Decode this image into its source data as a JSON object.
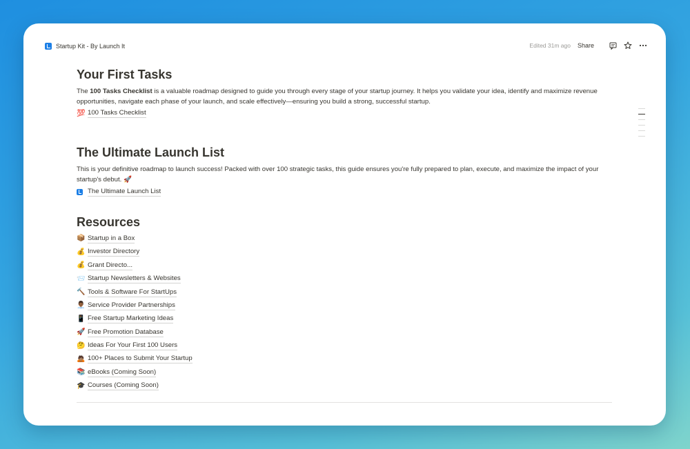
{
  "header": {
    "breadcrumb_title": "Startup Kit - By Launch It",
    "edited": "Edited 31m ago",
    "share_label": "Share"
  },
  "sections": {
    "first_tasks": {
      "title": "Your First Tasks",
      "desc_bold": "100 Tasks Checklist",
      "desc_pre": "The ",
      "desc_rest": " is a valuable roadmap designed to guide you through every stage of your startup journey. It helps you validate your idea, identify and maximize revenue opportunities, navigate each phase of your launch, and scale effectively—ensuring you build a strong, successful startup.",
      "link_emoji": "💯",
      "link_label": "100 Tasks Checklist"
    },
    "launch_list": {
      "title": "The Ultimate Launch List",
      "desc": "This is your definitive roadmap to launch success! Packed with over 100 strategic tasks, this guide ensures you're fully prepared to plan, execute, and maximize the impact of your startup's debut. 🚀",
      "link_label": "The Ultimate Launch List"
    },
    "resources": {
      "title": "Resources",
      "items": [
        {
          "emoji": "📦",
          "label": "Startup in a Box"
        },
        {
          "emoji": "💰",
          "label": "Investor Directory"
        },
        {
          "emoji": "💰",
          "label": "Grant Directo..."
        },
        {
          "emoji": "📨",
          "label": "Startup Newsletters & Websites"
        },
        {
          "emoji": "🔨",
          "label": "Tools & Software For StartUps"
        },
        {
          "emoji": "👨🏾‍💼",
          "label": "Service Provider Partnerships"
        },
        {
          "emoji": "📱",
          "label": "Free Startup Marketing Ideas"
        },
        {
          "emoji": "🚀",
          "label": "Free Promotion Database"
        },
        {
          "emoji": "🤔",
          "label": "Ideas For Your First 100 Users"
        },
        {
          "emoji": "🙇🏽",
          "label": "100+ Places to Submit Your Startup"
        },
        {
          "emoji": "📚",
          "label": "eBooks (Coming Soon)"
        },
        {
          "emoji": "🎓",
          "label": "Courses (Coming Soon)"
        }
      ]
    }
  },
  "icons": {
    "logo": "launch-it-logo-icon",
    "comment": "comment-icon",
    "favorite": "star-icon",
    "more": "more-icon"
  },
  "colors": {
    "brand": "#1c7fe6",
    "text": "#37352f",
    "muted": "#9b9a97"
  }
}
